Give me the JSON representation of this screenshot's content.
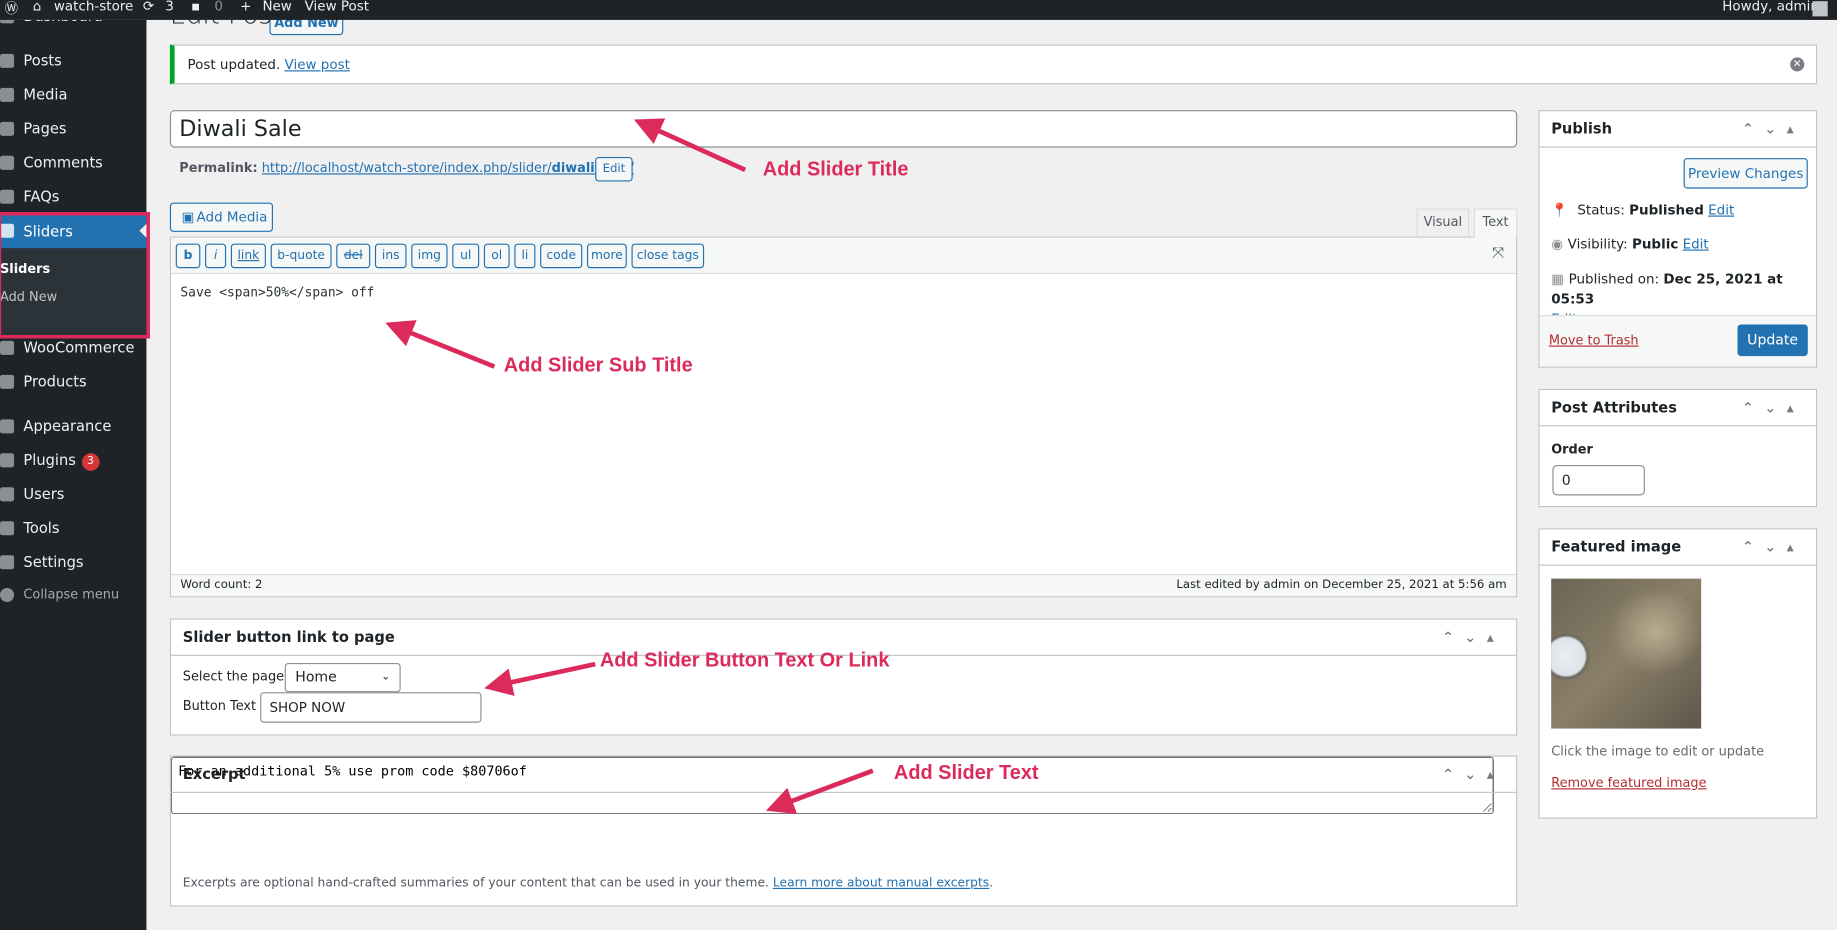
{
  "adminbar": {
    "site": "watch-store",
    "updates": "3",
    "comments": "0",
    "new": "New",
    "view_post": "View Post",
    "howdy": "Howdy, admin"
  },
  "sidebar": {
    "items": [
      {
        "label": "Dashboard"
      },
      {
        "label": "Posts"
      },
      {
        "label": "Media"
      },
      {
        "label": "Pages"
      },
      {
        "label": "Comments"
      },
      {
        "label": "FAQs"
      },
      {
        "label": "Sliders"
      },
      {
        "label": "WooCommerce"
      },
      {
        "label": "Products"
      },
      {
        "label": "Appearance"
      },
      {
        "label": "Plugins",
        "badge": "3"
      },
      {
        "label": "Users"
      },
      {
        "label": "Tools"
      },
      {
        "label": "Settings"
      },
      {
        "label": "Collapse menu"
      }
    ],
    "submenu": [
      "Sliders",
      "Add New"
    ]
  },
  "page": {
    "title": "Edit Post",
    "add_new": "Add New"
  },
  "notice": {
    "text": "Post updated.",
    "link": "View post",
    "accent": "#00a32a"
  },
  "post": {
    "title": "Diwali Sale",
    "permalink_label": "Permalink:",
    "permalink_base": "http://localhost/watch-store/index.php/slider/",
    "permalink_slug": "diwali-sale",
    "permalink_end": "/",
    "edit": "Edit"
  },
  "editor": {
    "add_media": "Add Media",
    "tabs": [
      "Visual",
      "Text"
    ],
    "active_tab": "Text",
    "quicktags": [
      "b",
      "i",
      "link",
      "b-quote",
      "del",
      "ins",
      "img",
      "ul",
      "ol",
      "li",
      "code",
      "more",
      "close tags"
    ],
    "content": "Save <span>50%</span> off",
    "word_count": "Word count: 2",
    "last_edited": "Last edited by admin on December 25, 2021 at 5:56 am"
  },
  "slider_link": {
    "title": "Slider button link to page",
    "select_label": "Select the page :",
    "select_value": "Home",
    "button_label": "Button Text :",
    "button_value": "SHOP NOW"
  },
  "excerpt": {
    "title": "Excerpt",
    "value": "For an additional 5% use prom code $80706of",
    "help": "Excerpts are optional hand-crafted summaries of your content that can be used in your theme.",
    "help_link": "Learn more about manual excerpts",
    "help_end": "."
  },
  "publish": {
    "title": "Publish",
    "preview": "Preview Changes",
    "status_label": "Status:",
    "status": "Published",
    "visibility_label": "Visibility:",
    "visibility": "Public",
    "published_label": "Published on:",
    "published": "Dec 25, 2021 at 05:53",
    "edit": "Edit",
    "trash": "Move to Trash",
    "update": "Update"
  },
  "attributes": {
    "title": "Post Attributes",
    "order_label": "Order",
    "order_value": "0"
  },
  "featured": {
    "title": "Featured image",
    "caption": "Click the image to edit or update",
    "remove": "Remove featured image"
  },
  "annotations": [
    "Add Slider Title",
    "Add Slider Sub Title",
    "Add Slider Button Text Or Link",
    "Add Slider Text"
  ],
  "colors": {
    "accent": "#2271b1",
    "annotation": "#dc2a5a",
    "sidebar": "#1d2327"
  }
}
